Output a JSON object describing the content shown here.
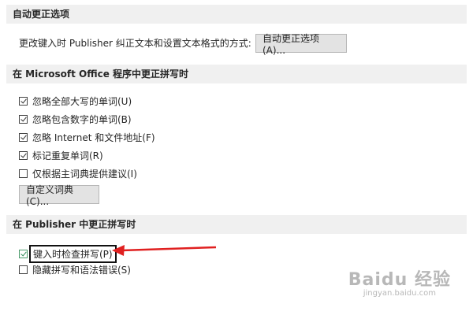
{
  "autocorrect_section": {
    "header": "自动更正选项",
    "description": "更改键入时 Publisher 纠正文本和设置文本格式的方式:",
    "button_label": "自动更正选项(A)..."
  },
  "office_section": {
    "header": "在 Microsoft Office 程序中更正拼写时",
    "options": [
      {
        "label": "忽略全部大写的单词(U)",
        "checked": true
      },
      {
        "label": "忽略包含数字的单词(B)",
        "checked": true
      },
      {
        "label": "忽略 Internet 和文件地址(F)",
        "checked": true
      },
      {
        "label": "标记重复单词(R)",
        "checked": true
      },
      {
        "label": "仅根据主词典提供建议(I)",
        "checked": false
      }
    ],
    "dictionary_button_label": "自定义词典(C)..."
  },
  "publisher_section": {
    "header": "在 Publisher 中更正拼写时",
    "options": [
      {
        "label": "键入时检查拼写(P)",
        "checked": true
      },
      {
        "label": "隐藏拼写和语法错误(S)",
        "checked": false
      }
    ]
  },
  "watermark": {
    "main": "Baidu 经验",
    "sub": "jingyan.baidu.com"
  },
  "colors": {
    "section_bg": "#f0f0f0",
    "button_bg": "#e3e3e3",
    "annotation_arrow": "#e02020"
  }
}
